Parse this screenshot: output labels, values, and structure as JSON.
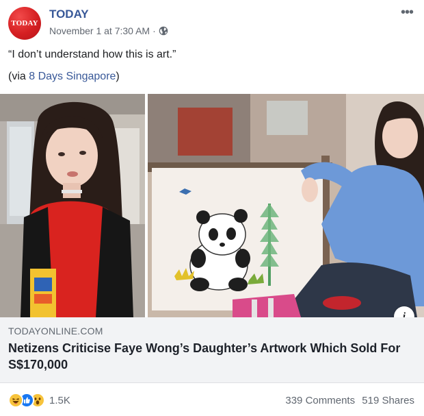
{
  "header": {
    "avatar_text": "TODAY",
    "page_name": "TODAY",
    "timestamp": "November 1 at 7:30 AM",
    "separator": "·",
    "privacy_icon": "globe-icon",
    "more_icon": "•••"
  },
  "post": {
    "text": "“I don’t understand how this is art.”",
    "via_prefix": "(via ",
    "via_link": "8 Days Singapore",
    "via_suffix": ")"
  },
  "link_preview": {
    "domain": "TODAYONLINE.COM",
    "title": "Netizens Criticise Faye Wong’s Daughter’s Artwork Which Sold For S$170,000",
    "info_icon": "i"
  },
  "footer": {
    "reaction_icons": [
      "haha-icon",
      "like-icon",
      "wow-icon"
    ],
    "reaction_count": "1.5K",
    "comments": "339 Comments",
    "shares": "519 Shares"
  },
  "colors": {
    "brand_red": "#d51f22",
    "link_blue": "#385898",
    "like_blue": "#1877f2",
    "reaction_yellow": "#f7c33b"
  }
}
